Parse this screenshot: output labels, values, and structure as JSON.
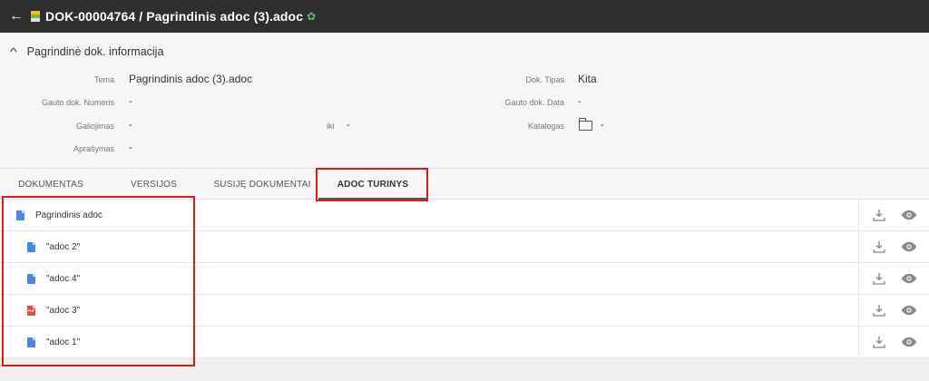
{
  "topbar": {
    "title": "DOK-00004764 / Pagrindinis adoc (3).adoc",
    "back_icon": "arrow-left-icon",
    "leaf_icon": "leaf-icon"
  },
  "info": {
    "section_title": "Pagrindinė dok. informacija",
    "fields": {
      "tema_label": "Tema",
      "tema_value": "Pagrindinis adoc (3).adoc",
      "gauto_numeris_label": "Gauto dok. Numeris",
      "gauto_numeris_value": "-",
      "galiojimas_label": "Galiojimas",
      "galiojimas_value": "-",
      "iki_label": "iki",
      "iki_value": "-",
      "aprasymas_label": "Aprašymas",
      "aprasymas_value": "-",
      "dok_tipas_label": "Dok. Tipas",
      "dok_tipas_value": "Kita",
      "gauto_data_label": "Gauto dok. Data",
      "gauto_data_value": "-",
      "katalogas_label": "Katalogas",
      "katalogas_value": "-"
    }
  },
  "tabs": [
    {
      "label": "DOKUMENTAS"
    },
    {
      "label": "VERSIJOS"
    },
    {
      "label": "SUSIJĘ DOKUMENTAI"
    },
    {
      "label": "ADOC TURINYS"
    }
  ],
  "active_tab": "ADOC TURINYS",
  "files": [
    {
      "name": "Pagrindinis adoc",
      "type": "doc"
    },
    {
      "name": "\"adoc 2\"",
      "type": "doc"
    },
    {
      "name": "\"adoc 4\"",
      "type": "doc"
    },
    {
      "name": "\"adoc 3\"",
      "type": "pdf",
      "badge": "PDF"
    },
    {
      "name": "\"adoc 1\"",
      "type": "doc"
    }
  ],
  "colors": {
    "topbar": "#2f2f2f",
    "doc_icon": "#4a86e8",
    "pdf_icon": "#e04a3f",
    "highlight": "#e0191d"
  }
}
